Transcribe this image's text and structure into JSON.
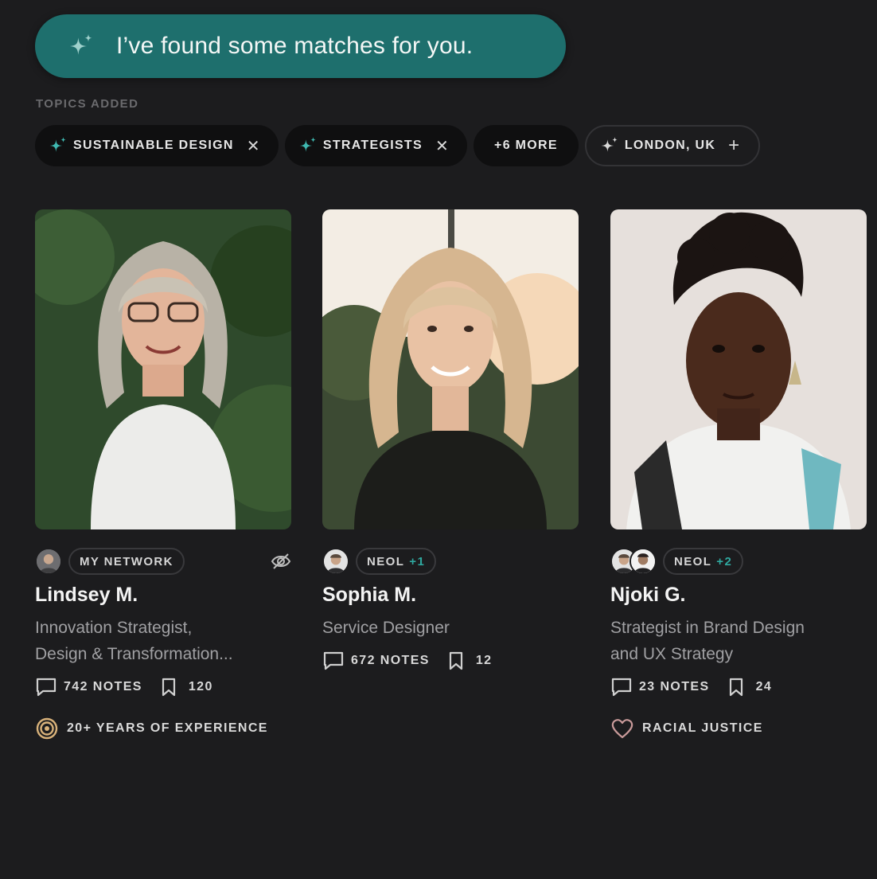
{
  "banner": {
    "text": "I’ve found some matches for you."
  },
  "topics": {
    "label": "TOPICS ADDED",
    "chips": [
      {
        "label": "SUSTAINABLE DESIGN"
      },
      {
        "label": "STRATEGISTS"
      },
      {
        "label": "+6 MORE"
      },
      {
        "label": "LONDON, UK"
      }
    ]
  },
  "colors": {
    "accent": "#1e6f6d",
    "teal_text": "#2fa89f",
    "background": "#1c1c1e"
  },
  "cards": [
    {
      "badge": "MY NETWORK",
      "badge_count": "",
      "name": "Lindsey M.",
      "role_line1": "Innovation Strategist,",
      "role_line2": "Design & Transformation...",
      "notes": "742 NOTES",
      "saves": "120",
      "extra": "20+ YEARS OF EXPERIENCE",
      "extra_icon": "target-icon"
    },
    {
      "badge": "NEOL",
      "badge_count": "+1",
      "name": "Sophia M.",
      "role_line1": "Service Designer",
      "role_line2": "",
      "notes": "672 NOTES",
      "saves": "12",
      "extra": "",
      "extra_icon": ""
    },
    {
      "badge": "NEOL",
      "badge_count": "+2",
      "name": "Njoki G.",
      "role_line1": "Strategist in Brand Design",
      "role_line2": "and UX Strategy",
      "notes": "23 NOTES",
      "saves": "24",
      "extra": "RACIAL JUSTICE",
      "extra_icon": "heart-icon"
    }
  ]
}
